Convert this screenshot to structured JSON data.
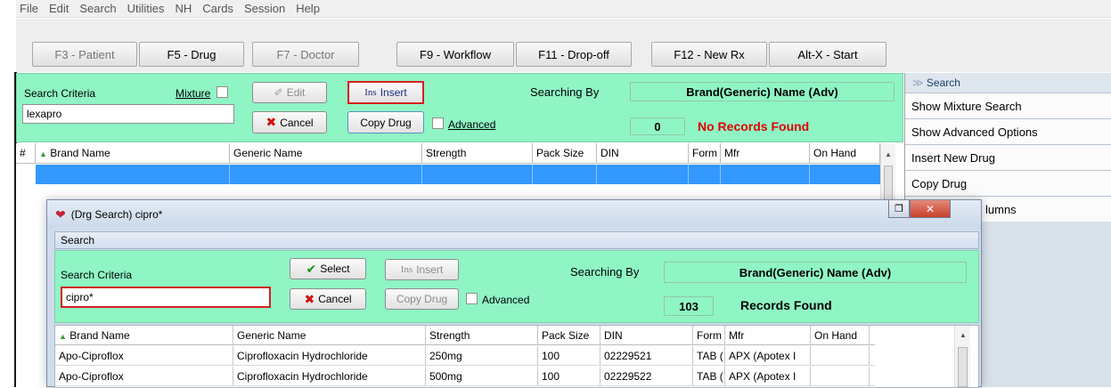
{
  "menu": [
    "File",
    "Edit",
    "Search",
    "Utilities",
    "NH",
    "Cards",
    "Session",
    "Help"
  ],
  "toolbar": {
    "buttons": [
      {
        "label": "F3 - Patient",
        "enabled": false
      },
      {
        "label": "F5 - Drug",
        "enabled": true
      },
      {
        "label": "F7 - Doctor",
        "enabled": false
      },
      {
        "label": "F9 - Workflow",
        "enabled": true
      },
      {
        "label": "F11 - Drop-off",
        "enabled": true
      },
      {
        "label": "F12 - New Rx",
        "enabled": true
      },
      {
        "label": "Alt-X - Start",
        "enabled": true
      }
    ]
  },
  "main": {
    "search_criteria_label": "Search Criteria",
    "mixture_label": "Mixture",
    "search_value": "lexapro",
    "edit_label": "Edit",
    "insert_label": "Insert",
    "insert_prefix": "Ins",
    "cancel_label": "Cancel",
    "copy_drug_label": "Copy Drug",
    "advanced_label": "Advanced",
    "searching_by_label": "Searching By",
    "searching_by_value": "Brand(Generic) Name (Adv)",
    "count": "0",
    "records_status": "No Records Found",
    "status_color": "#e00000"
  },
  "grid": {
    "columns": [
      "#",
      "Brand Name",
      "Generic Name",
      "Strength",
      "Pack Size",
      "DIN",
      "Form",
      "Mfr",
      "On Hand"
    ]
  },
  "sidepanel": {
    "header": "Search",
    "items": [
      "Show Mixture Search",
      "Show Advanced Options",
      "Insert New Drug",
      "Copy Drug",
      "lumns"
    ]
  },
  "dialog": {
    "title": "(Drg Search) cipro*",
    "section_label": "Search",
    "search_criteria_label": "Search Criteria",
    "search_value": "cipro*",
    "select_label": "Select",
    "insert_label": "Insert",
    "insert_prefix": "Ins",
    "cancel_label": "Cancel",
    "copy_drug_label": "Copy Drug",
    "advanced_label": "Advanced",
    "searching_by_label": "Searching By",
    "searching_by_value": "Brand(Generic) Name (Adv)",
    "count": "103",
    "records_status": "Records Found",
    "columns": [
      "Brand Name",
      "Generic Name",
      "Strength",
      "Pack Size",
      "DIN",
      "Form",
      "Mfr",
      "On Hand"
    ],
    "rows": [
      {
        "brand": "Apo-Ciproflox",
        "generic": "Ciprofloxacin Hydrochloride",
        "strength": "250mg",
        "pack": "100",
        "din": "02229521",
        "form": "TAB (",
        "mfr": "APX (Apotex I",
        "onhand": ""
      },
      {
        "brand": "Apo-Ciproflox",
        "generic": "Ciprofloxacin Hydrochloride",
        "strength": "500mg",
        "pack": "100",
        "din": "02229522",
        "form": "TAB (",
        "mfr": "APX (Apotex I",
        "onhand": ""
      }
    ]
  }
}
